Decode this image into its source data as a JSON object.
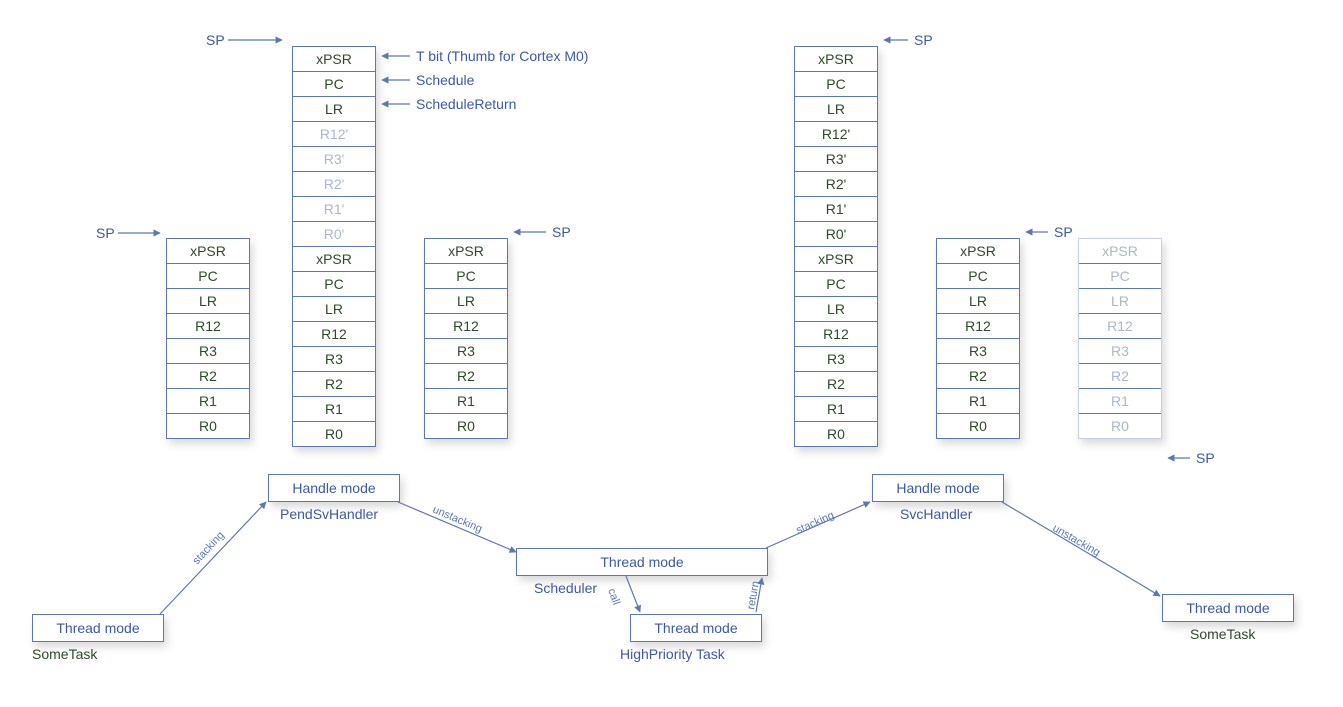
{
  "sp_label": "SP",
  "stacks": {
    "left_small": {
      "cells": [
        "xPSR",
        "PC",
        "LR",
        "R12",
        "R3",
        "R2",
        "R1",
        "R0"
      ]
    },
    "left_tall": {
      "cells": [
        "xPSR",
        "PC",
        "LR",
        "R12'",
        "R3'",
        "R2'",
        "R1'",
        "R0'",
        "xPSR",
        "PC",
        "LR",
        "R12",
        "R3",
        "R2",
        "R1",
        "R0"
      ]
    },
    "mid_small": {
      "cells": [
        "xPSR",
        "PC",
        "LR",
        "R12",
        "R3",
        "R2",
        "R1",
        "R0"
      ]
    },
    "right_tall": {
      "cells": [
        "xPSR",
        "PC",
        "LR",
        "R12'",
        "R3'",
        "R2'",
        "R1'",
        "R0'",
        "xPSR",
        "PC",
        "LR",
        "R12",
        "R3",
        "R2",
        "R1",
        "R0"
      ]
    },
    "right_small": {
      "cells": [
        "xPSR",
        "PC",
        "LR",
        "R12",
        "R3",
        "R2",
        "R1",
        "R0"
      ]
    },
    "right_faded": {
      "cells": [
        "xPSR",
        "PC",
        "LR",
        "R12",
        "R3",
        "R2",
        "R1",
        "R0"
      ]
    }
  },
  "annotations": {
    "tbit": "T bit (Thumb for Cortex M0)",
    "schedule": "Schedule",
    "schedule_return": "ScheduleReturn"
  },
  "mode_boxes": {
    "handle1": "Handle mode",
    "pendsv": "PendSvHandler",
    "thread1": "Thread mode",
    "sometask1": "SomeTask",
    "thread_mid": "Thread mode",
    "scheduler": "Scheduler",
    "thread_hp": "Thread mode",
    "highpriority": "HighPriority Task",
    "handle2": "Handle mode",
    "svchandler": "SvcHandler",
    "thread_right": "Thread mode",
    "sometask2": "SomeTask"
  },
  "edge_labels": {
    "stacking": "stacking",
    "unstacking": "unstacking",
    "call": "call",
    "return": "return"
  }
}
